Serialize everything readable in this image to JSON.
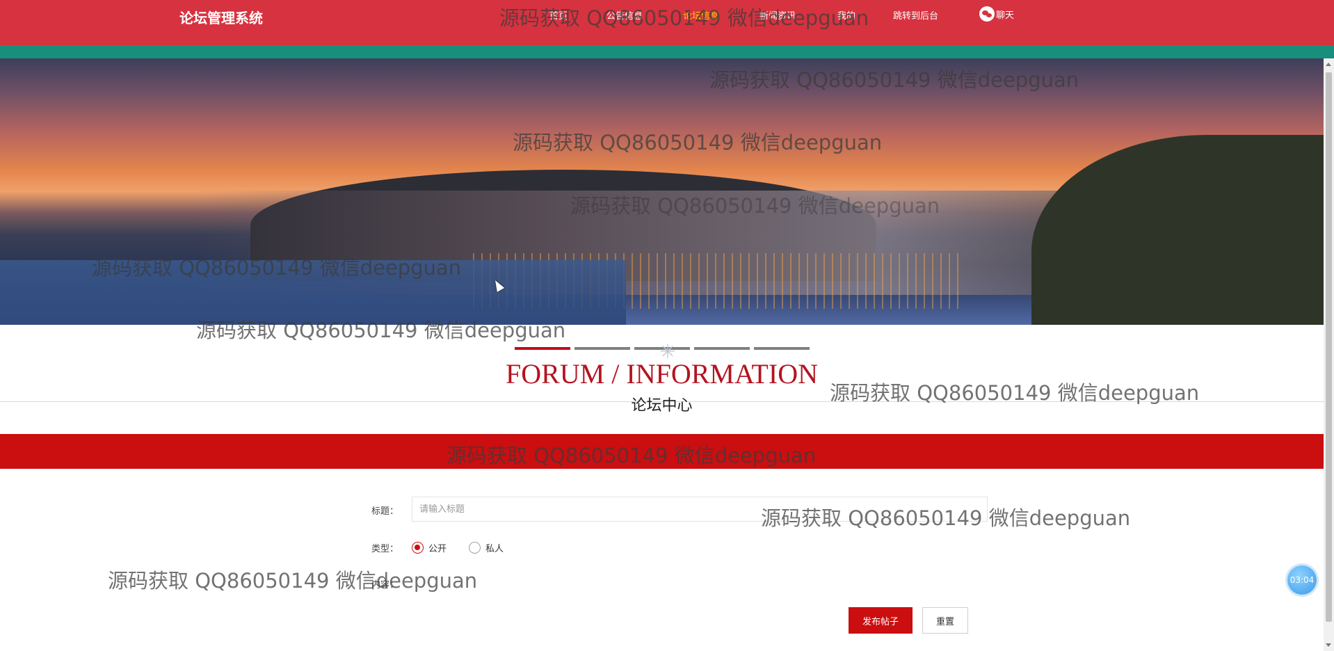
{
  "header": {
    "logo": "论坛管理系统",
    "nav": [
      {
        "label": "首页",
        "active": false
      },
      {
        "label": "公告信息",
        "active": false
      },
      {
        "label": "论坛信息",
        "active": true
      },
      {
        "label": "新闻资讯",
        "active": false
      },
      {
        "label": "我的",
        "active": false
      },
      {
        "label": "跳转到后台",
        "active": false
      }
    ],
    "chat_label": "聊天"
  },
  "section": {
    "title_en": "FORUM / INFORMATION",
    "title_cn": "论坛中心"
  },
  "form": {
    "title_label": "标题：",
    "title_placeholder": "请输入标题",
    "title_value": "",
    "type_label": "类型：",
    "type_options": [
      {
        "label": "公开",
        "checked": true
      },
      {
        "label": "私人",
        "checked": false
      }
    ],
    "content_label": "内容：",
    "submit_label": "发布帖子",
    "reset_label": "重置"
  },
  "timer": "03:04",
  "watermark": "源码获取 QQ86050149 微信deepguan",
  "colors": {
    "topbar": "#d7323f",
    "strip": "#1a8e7c",
    "accent": "#cb0e10",
    "nav_active": "#ffd000"
  }
}
